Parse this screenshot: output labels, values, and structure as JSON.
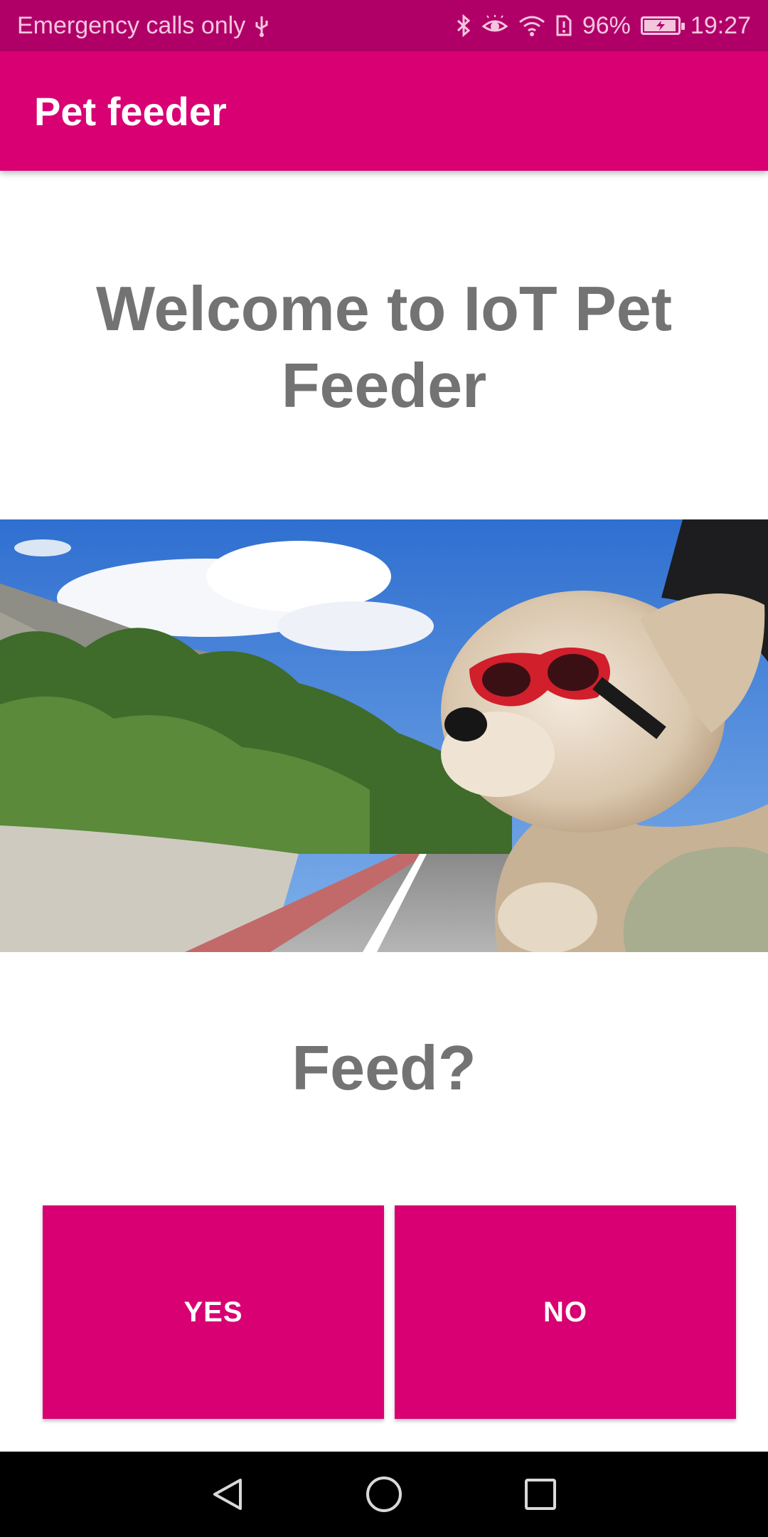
{
  "status_bar": {
    "carrier_text": "Emergency calls only",
    "battery_percent": "96%",
    "battery_level": 0.96,
    "time": "19:27",
    "icons": [
      "usb-icon",
      "bluetooth-icon",
      "eye-comfort-icon",
      "wifi-icon",
      "sim-icon",
      "battery-charging-icon"
    ]
  },
  "app_bar": {
    "title": "Pet feeder"
  },
  "main": {
    "welcome": "Welcome to IoT Pet Feeder",
    "question": "Feed?",
    "hero_image": "dog-with-goggles-in-car-window"
  },
  "actions": {
    "yes_label": "YES",
    "no_label": "NO"
  },
  "navigation": {
    "icons": [
      "back-icon",
      "home-icon",
      "recents-icon"
    ]
  },
  "colors": {
    "primary": "#d80073",
    "status_bar": "#b00068",
    "heading_text": "#737373",
    "nav_bar": "#000000"
  }
}
